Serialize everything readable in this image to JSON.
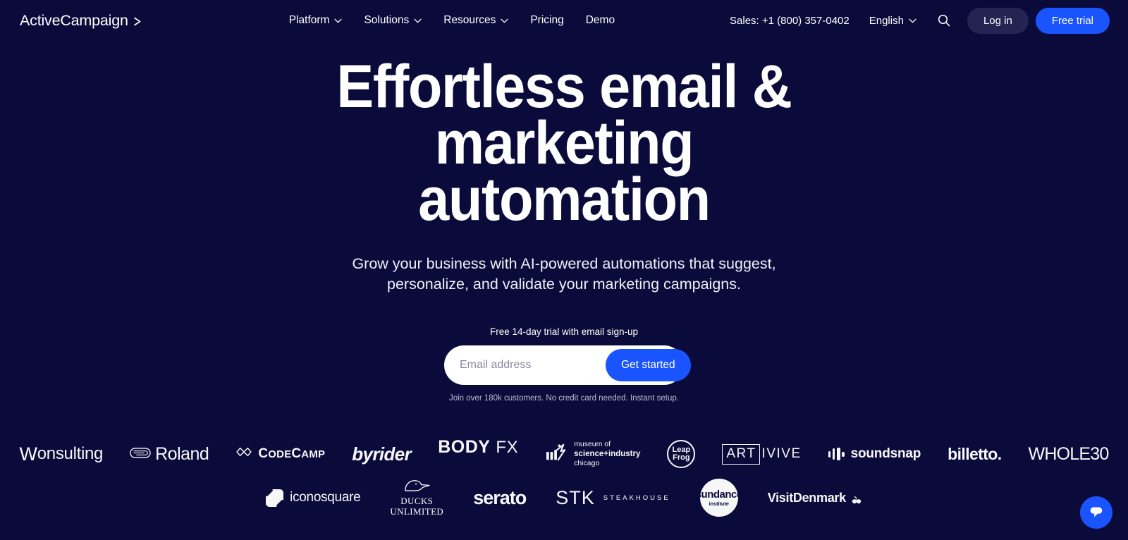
{
  "theme": {
    "background": "#0b0b3b",
    "accent_blue": "#1a54ff",
    "login_pill": "#242453",
    "text": "#ffffff"
  },
  "header": {
    "logo_text": "ActiveCampaign",
    "logo_icon": "chevron-right-icon",
    "nav": [
      {
        "label": "Platform",
        "has_dropdown": true
      },
      {
        "label": "Solutions",
        "has_dropdown": true
      },
      {
        "label": "Resources",
        "has_dropdown": true
      },
      {
        "label": "Pricing",
        "has_dropdown": false
      },
      {
        "label": "Demo",
        "has_dropdown": false
      }
    ],
    "sales_phone": "Sales: +1 (800) 357-0402",
    "language": "English",
    "search_icon": "search-icon",
    "login_label": "Log in",
    "trial_label": "Free trial"
  },
  "hero": {
    "title_line1": "Effortless email & marketing",
    "title_line2": "automation",
    "subtitle": "Grow your business with AI-powered automations that suggest, personalize, and validate your marketing campaigns.",
    "trial_note": "Free 14-day trial with email sign-up",
    "email_placeholder": "Email address",
    "email_value": "",
    "cta_label": "Get started",
    "fineprint": "Join over 180k customers. No credit card needed. Instant setup."
  },
  "logo_wall": {
    "row1": [
      {
        "name": "wonsulting",
        "text": "onsulting",
        "mark": "W"
      },
      {
        "name": "roland",
        "text": "Roland"
      },
      {
        "name": "codecamp",
        "text_a": "C",
        "text_b": "ODE",
        "text_c": "C",
        "text_d": "AMP"
      },
      {
        "name": "byrider",
        "text": "byrider"
      },
      {
        "name": "body-fx",
        "text_a": "BODY",
        "text_b": "FX"
      },
      {
        "name": "museum-of-science-industry-chicago",
        "line1": "museum of",
        "line2": "science+industry",
        "line3": "chicago"
      },
      {
        "name": "leapfrog",
        "line1": "Leap",
        "line2": "Frog"
      },
      {
        "name": "artivive",
        "text_a": "ART",
        "text_b": "IVIVE"
      },
      {
        "name": "soundsnap",
        "text": "soundsnap"
      },
      {
        "name": "billetto",
        "text": "billetto."
      },
      {
        "name": "whole30",
        "text": "WHOLE30"
      }
    ],
    "row2": [
      {
        "name": "iconosquare",
        "text": "iconosquare"
      },
      {
        "name": "ducks-unlimited",
        "line1": "DUCKS",
        "line2": "UNLIMITED"
      },
      {
        "name": "serato",
        "text": "serato"
      },
      {
        "name": "stk-steakhouse",
        "text_a": "STK",
        "text_b": "STEAKHOUSE"
      },
      {
        "name": "sundance-institute",
        "line1": "sundance",
        "line2": "institute"
      },
      {
        "name": "visitdenmark",
        "text": "VisitDenmark"
      }
    ]
  },
  "chat": {
    "icon": "chat-bubble-icon",
    "label": "Open chat"
  }
}
